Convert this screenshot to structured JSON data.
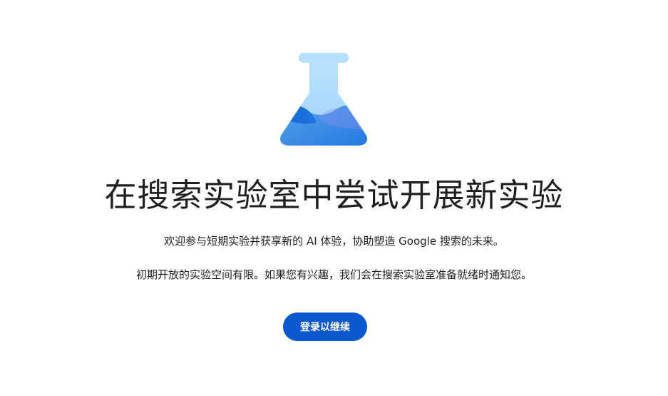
{
  "hero": {
    "icon": "flask-icon",
    "title": "在搜索实验室中尝试开展新实验",
    "description_1": "欢迎参与短期实验并获享新的 AI 体验，协助塑造 Google 搜索的未来。",
    "description_2": "初期开放的实验空间有限。如果您有兴趣，我们会在搜索实验室准备就绪时通知您。",
    "signin_label": "登录以继续"
  },
  "colors": {
    "button_bg": "#0b57d0",
    "button_text": "#ffffff",
    "flask_light": "#a8d8fb",
    "flask_dark": "#1a73e8"
  }
}
